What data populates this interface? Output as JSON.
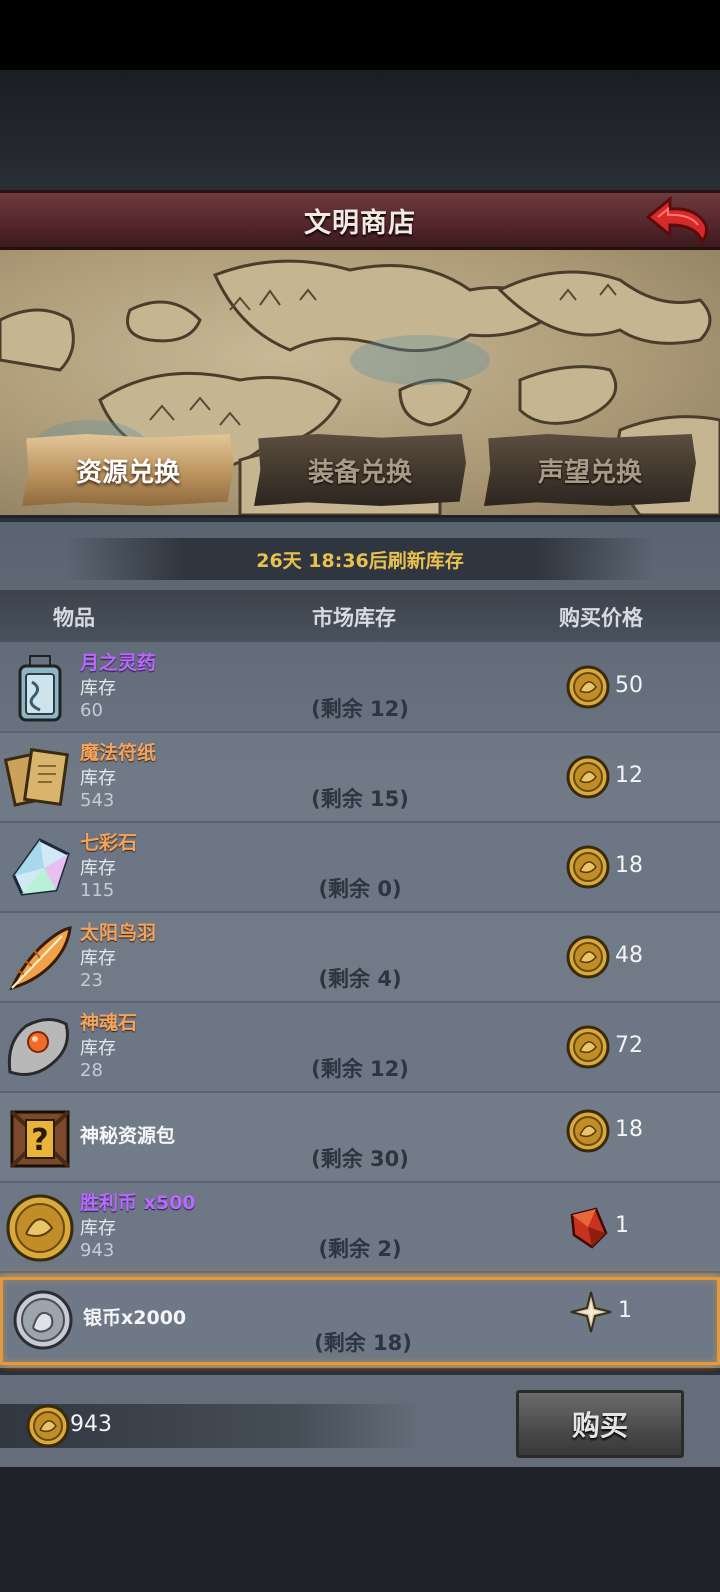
{
  "title": "文明商店",
  "tabs": [
    {
      "label": "资源兑换",
      "active": true
    },
    {
      "label": "装备兑换",
      "active": false
    },
    {
      "label": "声望兑换",
      "active": false
    }
  ],
  "refresh_text": "26天 18:36后刷新库存",
  "headers": {
    "item": "物品",
    "stock": "市场库存",
    "price": "购买价格"
  },
  "items": [
    {
      "name": "月之灵药",
      "name_color": "purple",
      "stock_label": "库存",
      "stock": "60",
      "remain": "(剩余 12)",
      "price": "50",
      "price_icon": "gold-coin-icon",
      "icon": "potion-bottle-icon"
    },
    {
      "name": "魔法符纸",
      "name_color": "orange",
      "stock_label": "库存",
      "stock": "543",
      "remain": "(剩余 15)",
      "price": "12",
      "price_icon": "gold-coin-icon",
      "icon": "magic-paper-icon"
    },
    {
      "name": "七彩石",
      "name_color": "orange",
      "stock_label": "库存",
      "stock": "115",
      "remain": "(剩余 0)",
      "price": "18",
      "price_icon": "gold-coin-icon",
      "icon": "rainbow-crystal-icon"
    },
    {
      "name": "太阳鸟羽",
      "name_color": "orange",
      "stock_label": "库存",
      "stock": "23",
      "remain": "(剩余 4)",
      "price": "48",
      "price_icon": "gold-coin-icon",
      "icon": "feather-icon"
    },
    {
      "name": "神魂石",
      "name_color": "orange",
      "stock_label": "库存",
      "stock": "28",
      "remain": "(剩余 12)",
      "price": "72",
      "price_icon": "gold-coin-icon",
      "icon": "soul-stone-icon"
    },
    {
      "name": "神秘资源包",
      "name_color": "white",
      "stock_label": "",
      "stock": "",
      "remain": "(剩余 30)",
      "price": "18",
      "price_icon": "gold-coin-icon",
      "icon": "mystery-crate-icon"
    },
    {
      "name": "胜利币 x500",
      "name_color": "purple",
      "stock_label": "库存",
      "stock": "943",
      "remain": "(剩余 2)",
      "price": "1",
      "price_icon": "red-crystal-icon",
      "icon": "victory-coin-icon"
    },
    {
      "name": "银币x2000",
      "name_color": "white",
      "stock_label": "",
      "stock": "",
      "remain": "(剩余 18)",
      "price": "1",
      "price_icon": "compass-star-icon",
      "icon": "silver-coin-icon"
    }
  ],
  "currency_total": "943",
  "buy_label": "购买",
  "colors": {
    "accent": "#e39a3a",
    "title_bar": "#5a2a2f",
    "gold_text": "#e8c24d"
  }
}
